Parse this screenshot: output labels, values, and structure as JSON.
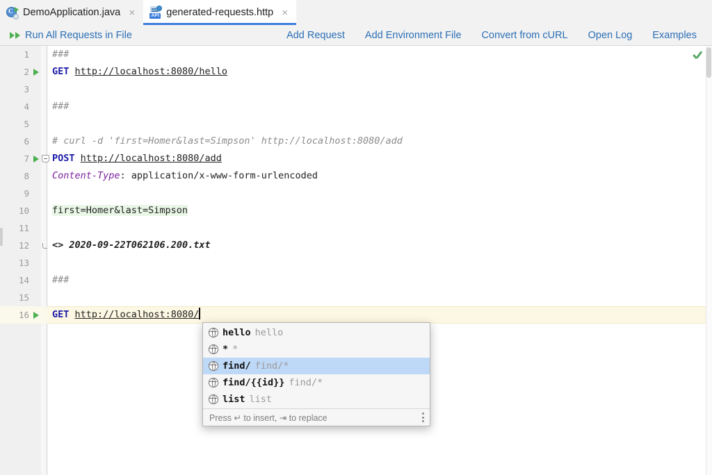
{
  "window": {
    "tabs": [
      {
        "label": "DemoApplication.java",
        "icon": "java-class-icon",
        "active": false,
        "close": "×"
      },
      {
        "label": "generated-requests.http",
        "icon": "api-file-icon",
        "active": true,
        "close": "×"
      }
    ]
  },
  "toolbar": {
    "run_all_label": "Run All Requests in File",
    "run_all_icon": "double-run-arrow-icon",
    "links": [
      "Add Request",
      "Add Environment File",
      "Convert from cURL",
      "Open Log",
      "Examples"
    ]
  },
  "editor": {
    "inspection_icon": "green-check-icon",
    "current_line": 16,
    "lines": [
      {
        "n": 1,
        "run": false,
        "fold": "",
        "tokens": [
          {
            "t": "comment",
            "s": "###"
          }
        ]
      },
      {
        "n": 2,
        "run": true,
        "fold": "",
        "tokens": [
          {
            "t": "method",
            "s": "GET"
          },
          {
            "t": "plain",
            "s": " "
          },
          {
            "t": "url",
            "s": "http://localhost:8080/hello"
          }
        ]
      },
      {
        "n": 3,
        "run": false,
        "fold": "",
        "tokens": []
      },
      {
        "n": 4,
        "run": false,
        "fold": "",
        "tokens": [
          {
            "t": "comment",
            "s": "###"
          }
        ]
      },
      {
        "n": 5,
        "run": false,
        "fold": "",
        "tokens": []
      },
      {
        "n": 6,
        "run": false,
        "fold": "",
        "tokens": [
          {
            "t": "comment",
            "s": "# curl -d 'first=Homer&last=Simpson' http://localhost:8080/add"
          }
        ]
      },
      {
        "n": 7,
        "run": true,
        "fold": "start",
        "tokens": [
          {
            "t": "method",
            "s": "POST"
          },
          {
            "t": "plain",
            "s": " "
          },
          {
            "t": "url",
            "s": "http://localhost:8080/add"
          }
        ]
      },
      {
        "n": 8,
        "run": false,
        "fold": "",
        "tokens": [
          {
            "t": "header",
            "s": "Content-Type"
          },
          {
            "t": "plain",
            "s": ": application/x-www-form-urlencoded"
          }
        ]
      },
      {
        "n": 9,
        "run": false,
        "fold": "",
        "tokens": []
      },
      {
        "n": 10,
        "run": false,
        "fold": "",
        "tokens": [
          {
            "t": "body",
            "s": "first=Homer&last=Simpson"
          }
        ]
      },
      {
        "n": 11,
        "run": false,
        "fold": "",
        "tokens": []
      },
      {
        "n": 12,
        "run": false,
        "fold": "end",
        "tokens": [
          {
            "t": "redir",
            "s": "<>"
          },
          {
            "t": "plain",
            "s": " "
          },
          {
            "t": "file",
            "s": "2020-09-22T062106.200.txt"
          }
        ]
      },
      {
        "n": 13,
        "run": false,
        "fold": "",
        "tokens": []
      },
      {
        "n": 14,
        "run": false,
        "fold": "",
        "tokens": [
          {
            "t": "comment",
            "s": "###"
          }
        ]
      },
      {
        "n": 15,
        "run": false,
        "fold": "",
        "tokens": []
      },
      {
        "n": 16,
        "run": true,
        "fold": "",
        "caret": true,
        "tokens": [
          {
            "t": "method",
            "s": "GET"
          },
          {
            "t": "plain",
            "s": " "
          },
          {
            "t": "url",
            "s": "http://localhost:8080/"
          }
        ]
      }
    ]
  },
  "autocomplete": {
    "items": [
      {
        "main": "hello",
        "tail": "hello",
        "icon": "globe-icon",
        "selected": false
      },
      {
        "main": "*",
        "tail": "*",
        "icon": "globe-icon",
        "selected": false
      },
      {
        "main": "find/",
        "tail": "find/*",
        "icon": "globe-icon",
        "selected": true
      },
      {
        "main": "find/{{id}}",
        "tail": "find/*",
        "icon": "globe-icon",
        "selected": false
      },
      {
        "main": "list",
        "tail": "list",
        "icon": "globe-icon",
        "selected": false
      }
    ],
    "footer_hint": "Press ↵ to insert, ⇥ to replace",
    "footer_menu_icon": "kebab-menu-icon"
  },
  "colors": {
    "accent_link": "#2b6fb5",
    "run_green": "#4caf50",
    "tab_underline": "#3b7ddd",
    "selection_blue": "#bed8f7",
    "current_line_yellow": "#fdf8e3",
    "body_green": "#e9f7e6",
    "method_blue": "#1a1aa8",
    "header_purple": "#7a1f9c",
    "comment_gray": "#8c8c8c"
  }
}
